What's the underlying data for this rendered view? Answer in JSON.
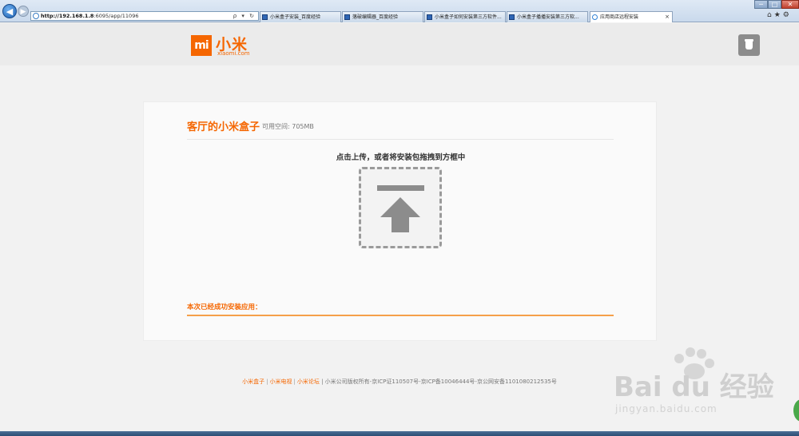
{
  "browser": {
    "url_host": "http://192.168.1.8",
    "url_rest": ":6095/app/11096",
    "address_icons": "ρ ▾ ↻",
    "tabs": [
      {
        "label": "小米盒子安装_百度经验"
      },
      {
        "label": "落破编辑器_百度经验"
      },
      {
        "label": "小米盒子如何安装第三方软件..."
      },
      {
        "label": "小米盒子播播安装第三方软..."
      },
      {
        "label": "应用商店远程安装",
        "active": true
      }
    ],
    "close_glyph": "×",
    "window_controls": {
      "minimize": "─",
      "maximize": "□",
      "close": "✕"
    },
    "tool_icons": "⌂★⚙"
  },
  "header": {
    "logo_mark": "mi",
    "logo_text": "小米",
    "logo_subtext": "xiaomi.com",
    "user_icon": "trash-icon"
  },
  "card": {
    "title": "客厅的小米盒子",
    "space_label": "可用空间: 705MB",
    "upload_hint": "点击上传，或者将安装包拖拽到方框中",
    "installed_label": "本次已经成功安装应用："
  },
  "footer": {
    "links": [
      "小米盒子",
      "小米电视",
      "小米论坛"
    ],
    "separator": "|",
    "copyright": "| 小米公司版权所有-京ICP证110507号-京ICP备10046444号-京公网安备1101080212535号"
  },
  "watermark": {
    "main": "Bai  du 经验",
    "sub": "jingyan.baidu.com"
  },
  "colors": {
    "brand": "#f56600",
    "upload_icon": "#8c8c8c"
  }
}
